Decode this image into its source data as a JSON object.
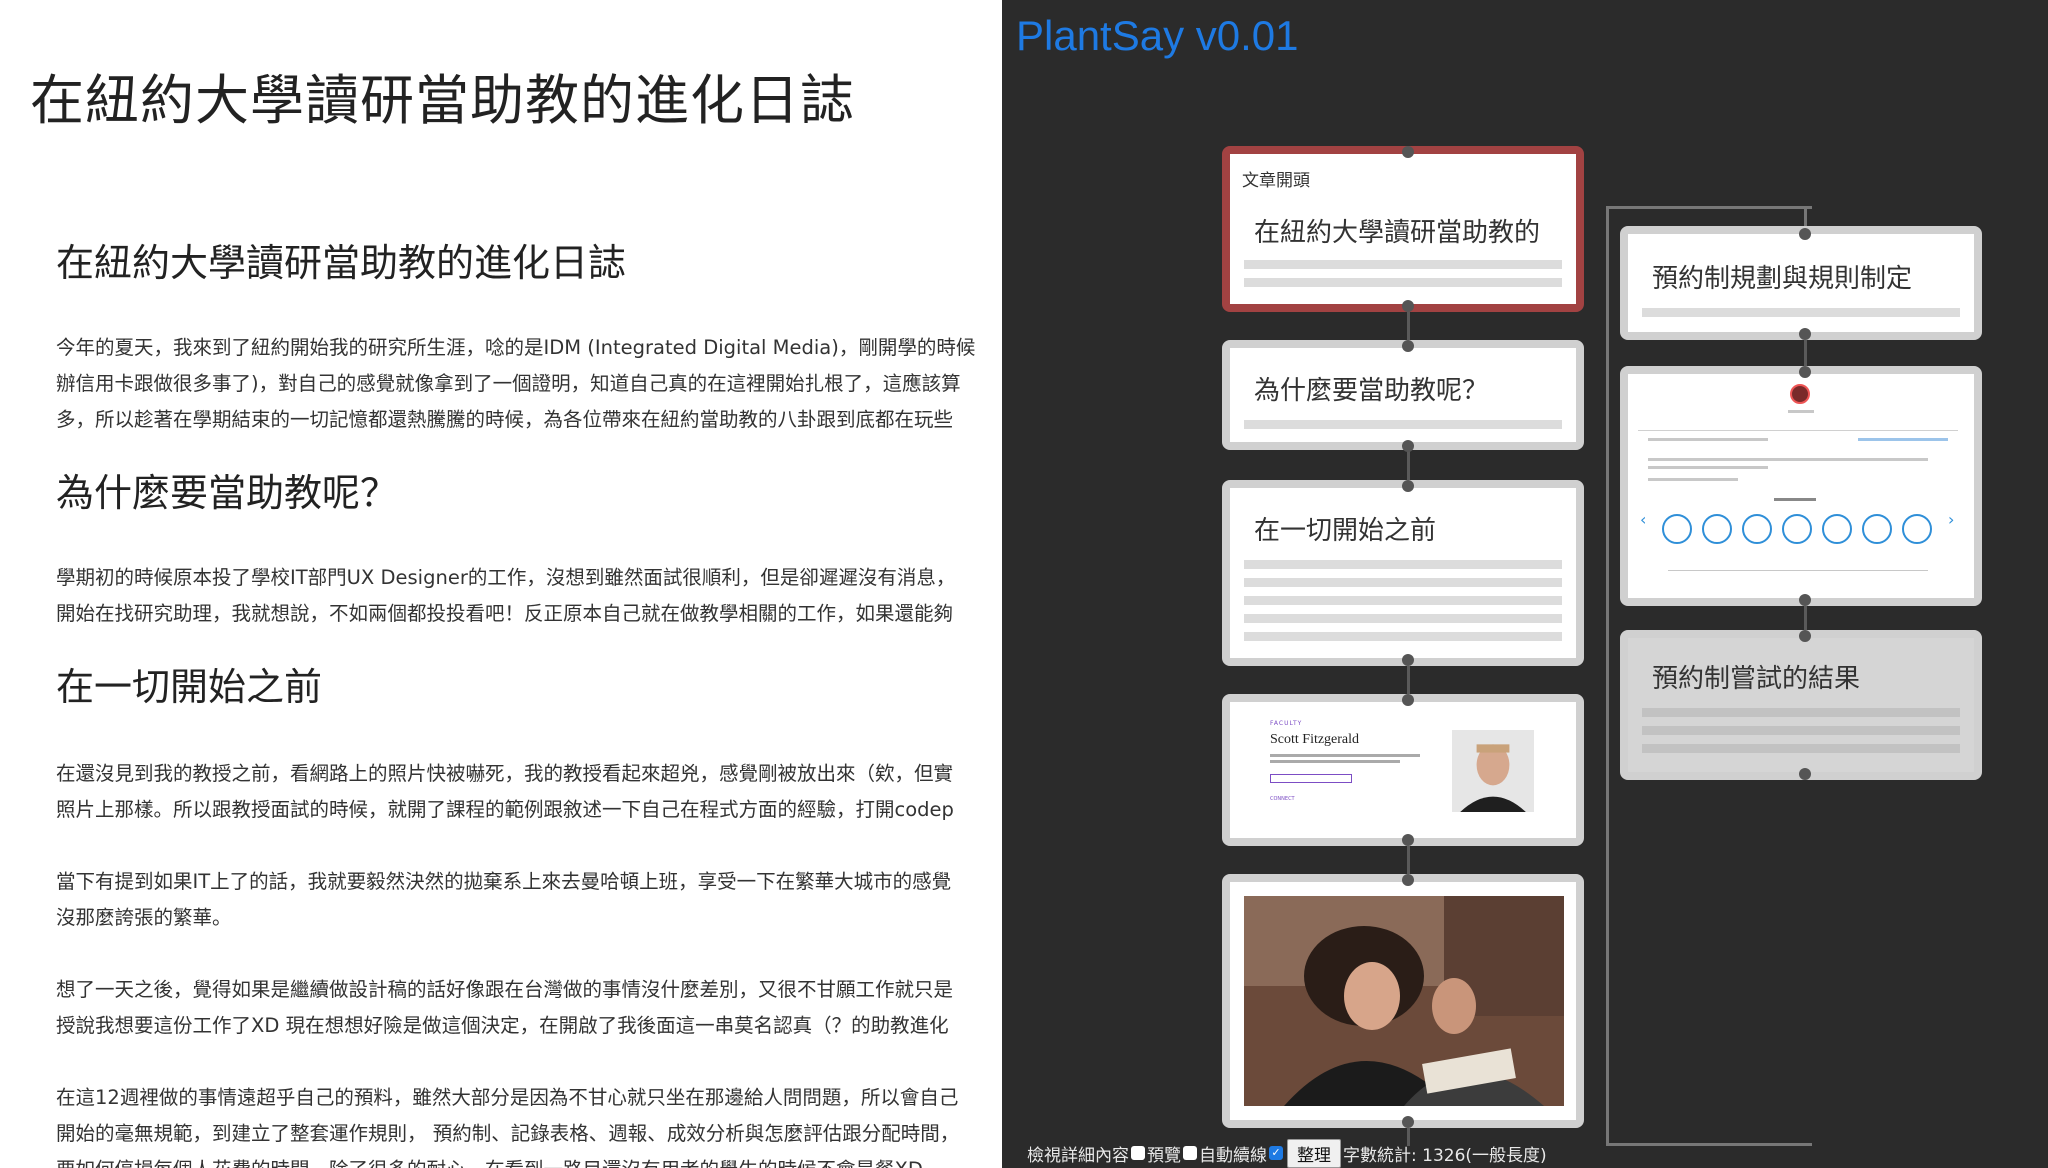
{
  "document": {
    "page_title": "在紐約大學讀研當助教的進化日誌",
    "sections": [
      {
        "heading": "在紐約大學讀研當助教的進化日誌",
        "lines": [
          "今年的夏天，我來到了紐約開始我的研究所生涯，唸的是IDM (Integrated Digital Media)，剛開學的時候",
          "辦信用卡跟做很多事了)，對自己的感覺就像拿到了一個證明，知道自己真的在這裡開始扎根了，這應該算",
          "多，所以趁著在學期結束的一切記憶都還熱騰騰的時候，為各位帶來在紐約當助教的八卦跟到底都在玩些"
        ]
      },
      {
        "heading": "為什麼要當助教呢？",
        "lines": [
          "學期初的時候原本投了學校IT部門UX Designer的工作，沒想到雖然面試很順利，但是卻遲遲沒有消息，",
          "開始在找研究助理，我就想說，不如兩個都投投看吧！反正原本自己就在做教學相關的工作，如果還能夠"
        ]
      },
      {
        "heading": "在一切開始之前",
        "paragraphs": [
          [
            "在還沒見到我的教授之前，看網路上的照片快被嚇死，我的教授看起來超兇，感覺剛被放出來（欸，但實",
            "照片上那樣。所以跟教授面試的時候，就開了課程的範例跟敘述一下自己在程式方面的經驗，打開codep"
          ],
          [
            "當下有提到如果IT上了的話，我就要毅然決然的拋棄系上來去曼哈頓上班，享受一下在繁華大城市的感覺",
            "沒那麼誇張的繁華。"
          ],
          [
            "想了一天之後，覺得如果是繼續做設計稿的話好像跟在台灣做的事情沒什麼差別，又很不甘願工作就只是",
            "授說我想要這份工作了XD 現在想想好險是做這個決定，在開啟了我後面這一串莫名認真（？的助教進化"
          ],
          [
            "在這12週裡做的事情遠超乎自己的預料，雖然大部分是因為不甘心就只坐在那邊給人問問題，所以會自己",
            "開始的毫無規範，到建立了整套運作規則， 預約制、記錄表格、週報、成效分析與怎麼評估跟分配時間，",
            "要如何停損每個人花費的時間，除了很多的耐心，在看到一路目還沒有用者的學生的時候不會是餐XD"
          ]
        ]
      }
    ]
  },
  "app": {
    "title": "PlantSay v0.01",
    "cards": {
      "intro": {
        "label": "文章開頭",
        "title": "在紐約大學讀研當助教的"
      },
      "why": {
        "title": "為什麼要當助教呢？"
      },
      "before": {
        "title": "在一切開始之前"
      },
      "profile": {
        "faculty": "FACULTY",
        "name": "Scott Fitzgerald",
        "connect": "CONNECT"
      },
      "booking_plan": {
        "title": "預約制規劃與規則制定"
      },
      "booking_result": {
        "title": "預約制嘗試的結果"
      }
    },
    "toolbar": {
      "view_details": "檢視詳細內容",
      "preview": "預覽",
      "auto_connect": "自動續線",
      "auto_connect_checked": true,
      "organize_button": "整理",
      "word_count": "字數統計: 1326(一般長度)"
    }
  }
}
